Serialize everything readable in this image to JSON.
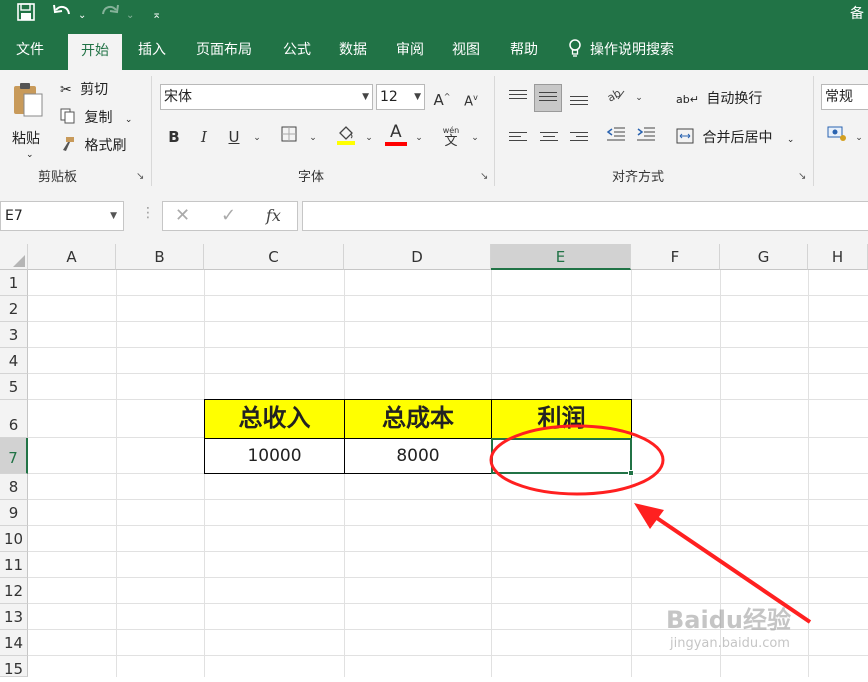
{
  "title_bar": {
    "save_icon": "save-icon",
    "undo_icon": "undo-icon",
    "redo_icon": "redo-icon",
    "customize_icon": "customize-quick-access-icon",
    "right_text": "备"
  },
  "tabs": [
    {
      "label": "文件"
    },
    {
      "label": "开始"
    },
    {
      "label": "插入"
    },
    {
      "label": "页面布局"
    },
    {
      "label": "公式"
    },
    {
      "label": "数据"
    },
    {
      "label": "审阅"
    },
    {
      "label": "视图"
    },
    {
      "label": "帮助"
    }
  ],
  "search": {
    "label": "操作说明搜索",
    "icon": "lightbulb-icon"
  },
  "clipboard": {
    "paste_label": "粘贴",
    "cut_label": "剪切",
    "copy_label": "复制",
    "format_painter_label": "格式刷",
    "group_label": "剪贴板"
  },
  "font": {
    "font_name": "宋体",
    "font_size": "12",
    "bold": "B",
    "italic": "I",
    "underline": "U",
    "grow": "A",
    "shrink": "A",
    "font_color_letter": "A",
    "phonetic": "wén",
    "phonetic_char": "文",
    "group_label": "字体",
    "fill_color": "#ffff00",
    "font_color": "#ff0000"
  },
  "alignment": {
    "wrap_text_label": "自动换行",
    "merge_center_label": "合并后居中",
    "group_label": "对齐方式"
  },
  "number": {
    "format": "常规"
  },
  "formula_bar": {
    "name_box": "E7",
    "cancel_icon": "✕",
    "enter_icon": "✓",
    "fx_label": "fx",
    "content": ""
  },
  "columns": [
    "A",
    "B",
    "C",
    "D",
    "E",
    "F",
    "G",
    "H"
  ],
  "rows": [
    "1",
    "2",
    "3",
    "4",
    "5",
    "6",
    "7",
    "8",
    "9",
    "10",
    "11",
    "12",
    "13",
    "14",
    "15"
  ],
  "selected_cell": "E7",
  "cells": {
    "C6": "总收入",
    "D6": "总成本",
    "E6": "利润",
    "C7": "10000",
    "D7": "8000",
    "E7": ""
  },
  "annotation": {
    "color": "#ff0000"
  },
  "watermark": {
    "line1": "Baidu经验",
    "line2": "jingyan.baidu.com"
  }
}
